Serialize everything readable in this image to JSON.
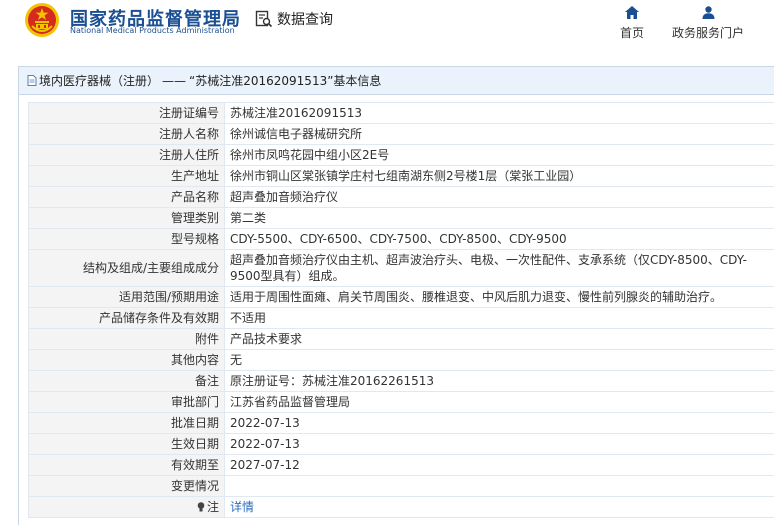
{
  "header": {
    "site_name_cn": "国家药品监督管理局",
    "site_name_en": "National Medical Products Administration",
    "data_query_label": "数据查询",
    "nav": [
      {
        "label": "首页",
        "icon": "home-icon"
      },
      {
        "label": "政务服务门户",
        "icon": "user-icon"
      }
    ]
  },
  "breadcrumb": {
    "category": "境内医疗器械（注册）",
    "separator": "——",
    "title": "“苏械注准20162091513”基本信息"
  },
  "fields": [
    {
      "label": "注册证编号",
      "value": "苏械注准20162091513"
    },
    {
      "label": "注册人名称",
      "value": "徐州诚信电子器械研究所"
    },
    {
      "label": "注册人住所",
      "value": "徐州市凤鸣花园中组小区2E号"
    },
    {
      "label": "生产地址",
      "value": "徐州市铜山区棠张镇学庄村七组南湖东侧2号楼1层（棠张工业园）"
    },
    {
      "label": "产品名称",
      "value": "超声叠加音频治疗仪"
    },
    {
      "label": "管理类别",
      "value": "第二类"
    },
    {
      "label": "型号规格",
      "value": "CDY-5500、CDY-6500、CDY-7500、CDY-8500、CDY-9500"
    },
    {
      "label": "结构及组成/主要组成成分",
      "value": "超声叠加音频治疗仪由主机、超声波治疗头、电极、一次性配件、支承系统（仅CDY-8500、CDY-9500型具有）组成。"
    },
    {
      "label": "适用范围/预期用途",
      "value": "适用于周围性面瘫、肩关节周围炎、腰椎退变、中风后肌力退变、慢性前列腺炎的辅助治疗。"
    },
    {
      "label": "产品储存条件及有效期",
      "value": "不适用"
    },
    {
      "label": "附件",
      "value": "产品技术要求"
    },
    {
      "label": "其他内容",
      "value": "无"
    },
    {
      "label": "备注",
      "value": "原注册证号：苏械注准20162261513"
    },
    {
      "label": "审批部门",
      "value": "江苏省药品监督管理局"
    },
    {
      "label": "批准日期",
      "value": "2022-07-13"
    },
    {
      "label": "生效日期",
      "value": "2022-07-13"
    },
    {
      "label": "有效期至",
      "value": "2027-07-12"
    },
    {
      "label": "变更情况",
      "value": ""
    },
    {
      "label": "注",
      "value": "详情"
    }
  ],
  "colors": {
    "brand": "#1b4f93",
    "link": "#2a6ebf",
    "label_bg": "#f4f4f4",
    "title_bar_bg": "#eaf2fb",
    "emblem_red": "#d52b1e",
    "emblem_gold": "#f5c400"
  }
}
